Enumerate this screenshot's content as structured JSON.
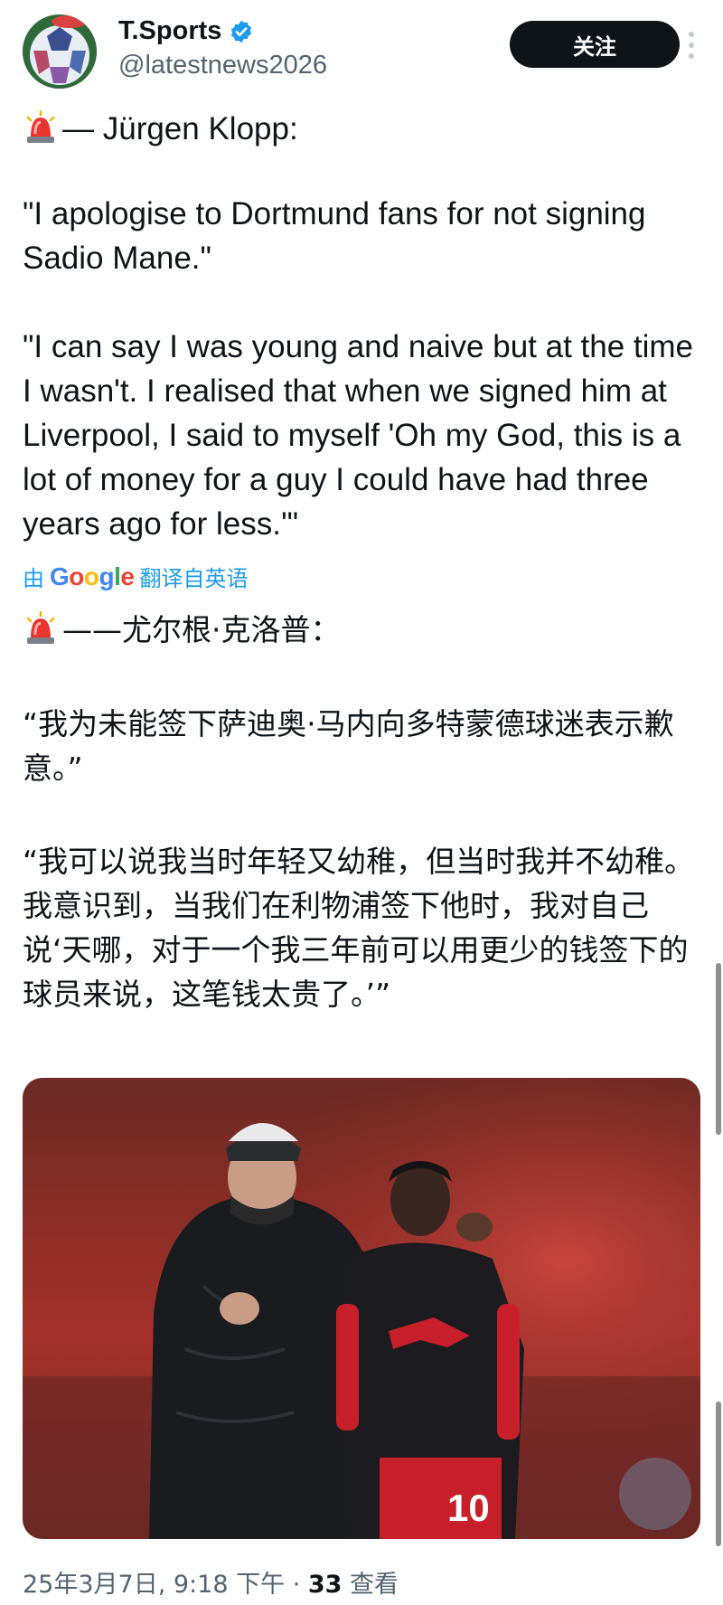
{
  "account": {
    "display_name": "T.Sports",
    "handle": "@latestnews2026",
    "follow_label": "关注",
    "verified_icon": "verified-badge-icon"
  },
  "tweet": {
    "heading_en": "— Jürgen Klopp:",
    "quote1_en": "\"I apologise to Dortmund fans for not signing Sadio Mane.\"",
    "quote2_en": "\"I can say I was young and naive but at the time I wasn't. I realised that when we signed him at Liverpool, I said to myself 'Oh my God, this is a lot of money for a guy I could have had three years ago for less.'\"",
    "translate_prefix": "由",
    "translate_brand": "Google",
    "translate_suffix": "翻译自英语",
    "heading_cn": "——尤尔根·克洛普：",
    "quote1_cn": "“我为未能签下萨迪奥·马内向多特蒙德球迷表示歉意。”",
    "quote2_cn": "“我可以说我当时年轻又幼稚，但当时我并不幼稚。我意识到，当我们在利物浦签下他时，我对自己说‘天哪，对于一个我三年前可以用更少的钱签下的球员来说，这笔钱太贵了。’”"
  },
  "meta": {
    "timestamp": "25年3月7日, 9:18 下午 · ",
    "views_count": "33",
    "views_label": " 查看"
  },
  "colors": {
    "accent": "#1d9bf0",
    "text": "#0f1419",
    "muted": "#536471",
    "button": "#0f1419"
  }
}
